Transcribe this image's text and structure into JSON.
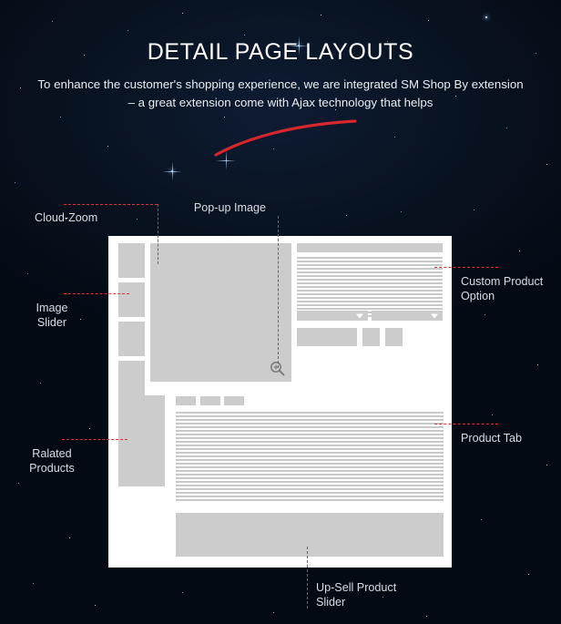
{
  "header": {
    "title": "DETAIL PAGE LAYOUTS",
    "subtitle": "To enhance the customer's shopping experience, we are integrated SM Shop By extension – a great extension come with Ajax technology that helps"
  },
  "theme": {
    "background": "#040a14",
    "card": "#ffffff",
    "block": "#cccccc",
    "accent": "#e0313a",
    "label_text": "#d9dde3",
    "title_text": "#ffffff"
  },
  "callouts": [
    {
      "id": "cloud-zoom",
      "label": "Cloud-Zoom",
      "side": "left"
    },
    {
      "id": "image-slider",
      "label": "Image\nSlider",
      "label_line1": "Image",
      "label_line2": "Slider",
      "side": "left"
    },
    {
      "id": "related-products",
      "label": "Ralated\nProducts",
      "label_line1": "Ralated",
      "label_line2": "Products",
      "side": "left"
    },
    {
      "id": "popup-image",
      "label": "Pop-up Image",
      "side": "top"
    },
    {
      "id": "custom-product-option",
      "label": "Custom Product\nOption",
      "label_line1": "Custom Product",
      "label_line2": "Option",
      "side": "right"
    },
    {
      "id": "product-tab",
      "label": "Product Tab",
      "side": "right"
    },
    {
      "id": "upsell-slider",
      "label": "Up-Sell Product\nSlider",
      "label_line1": "Up-Sell Product",
      "label_line2": "Slider",
      "side": "bottom"
    }
  ],
  "wireframe": {
    "thumbnails_count": 4,
    "main_image": {
      "has_zoom_icon": true,
      "zoom_icon": "magnifier-plus-icon"
    },
    "right_panel": {
      "title_bar": true,
      "description_lines": true,
      "selects": [
        {
          "icon": "chevron-down-icon"
        },
        {
          "icon": "chevron-down-icon"
        }
      ],
      "buttons": [
        {
          "name": "add-to-cart-button"
        },
        {
          "name": "wishlist-button"
        },
        {
          "name": "compare-button"
        }
      ]
    },
    "tabs_count": 3,
    "upsell_block": true
  }
}
